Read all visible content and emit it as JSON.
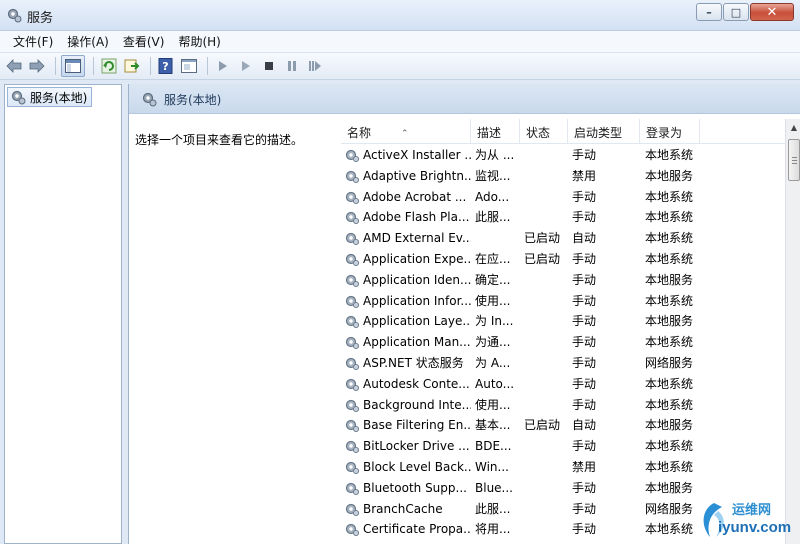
{
  "window": {
    "title": "服务"
  },
  "menu": [
    "文件(F)",
    "操作(A)",
    "查看(V)",
    "帮助(H)"
  ],
  "tree": {
    "label": "服务(本地)"
  },
  "pane": {
    "header": "服务(本地)",
    "description": "选择一个项目来查看它的描述。"
  },
  "table": {
    "columns": {
      "name": "名称",
      "desc": "描述",
      "state": "状态",
      "start": "启动类型",
      "logon": "登录为"
    },
    "rows": [
      {
        "name": "ActiveX Installer ...",
        "desc": "为从 ...",
        "state": "",
        "start": "手动",
        "logon": "本地系统"
      },
      {
        "name": "Adaptive Brightn...",
        "desc": "监视...",
        "state": "",
        "start": "禁用",
        "logon": "本地服务"
      },
      {
        "name": "Adobe Acrobat ...",
        "desc": "Ado...",
        "state": "",
        "start": "手动",
        "logon": "本地系统"
      },
      {
        "name": "Adobe Flash Pla...",
        "desc": "此服...",
        "state": "",
        "start": "手动",
        "logon": "本地系统"
      },
      {
        "name": "AMD External Ev...",
        "desc": "",
        "state": "已启动",
        "start": "自动",
        "logon": "本地系统"
      },
      {
        "name": "Application Expe...",
        "desc": "在应...",
        "state": "已启动",
        "start": "手动",
        "logon": "本地系统"
      },
      {
        "name": "Application Iden...",
        "desc": "确定...",
        "state": "",
        "start": "手动",
        "logon": "本地服务"
      },
      {
        "name": "Application Infor...",
        "desc": "使用...",
        "state": "",
        "start": "手动",
        "logon": "本地系统"
      },
      {
        "name": "Application Laye...",
        "desc": "为 In...",
        "state": "",
        "start": "手动",
        "logon": "本地服务"
      },
      {
        "name": "Application Man...",
        "desc": "为通...",
        "state": "",
        "start": "手动",
        "logon": "本地系统"
      },
      {
        "name": "ASP.NET 状态服务",
        "desc": "为 A...",
        "state": "",
        "start": "手动",
        "logon": "网络服务"
      },
      {
        "name": "Autodesk Conte...",
        "desc": "Auto...",
        "state": "",
        "start": "手动",
        "logon": "本地系统"
      },
      {
        "name": "Background Inte...",
        "desc": "使用...",
        "state": "",
        "start": "手动",
        "logon": "本地系统"
      },
      {
        "name": "Base Filtering En...",
        "desc": "基本...",
        "state": "已启动",
        "start": "自动",
        "logon": "本地服务"
      },
      {
        "name": "BitLocker Drive ...",
        "desc": "BDE...",
        "state": "",
        "start": "手动",
        "logon": "本地系统"
      },
      {
        "name": "Block Level Back...",
        "desc": "Win...",
        "state": "",
        "start": "禁用",
        "logon": "本地系统"
      },
      {
        "name": "Bluetooth Supp...",
        "desc": "Blue...",
        "state": "",
        "start": "手动",
        "logon": "本地服务"
      },
      {
        "name": "BranchCache",
        "desc": "此服...",
        "state": "",
        "start": "手动",
        "logon": "网络服务"
      },
      {
        "name": "Certificate Propa...",
        "desc": "将用...",
        "state": "",
        "start": "手动",
        "logon": "本地系统"
      }
    ]
  },
  "watermark": {
    "top": "运维网",
    "bottom": "iyunv.com"
  }
}
